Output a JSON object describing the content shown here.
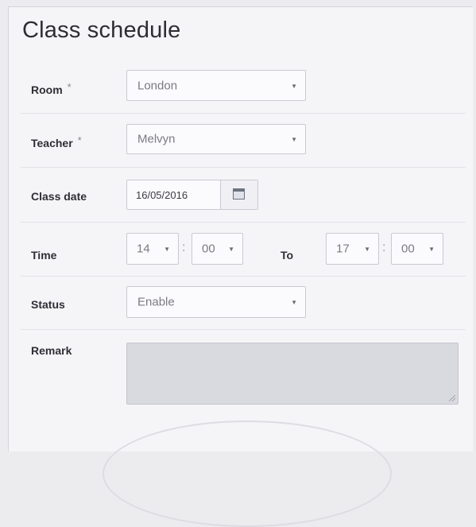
{
  "form": {
    "title": "Class schedule",
    "room": {
      "label": "Room",
      "required_mark": "*",
      "value": "London"
    },
    "teacher": {
      "label": "Teacher",
      "required_mark": "*",
      "value": "Melvyn"
    },
    "class_date": {
      "label": "Class date",
      "value": "16/05/2016",
      "icon": "calendar-icon"
    },
    "time": {
      "label": "Time",
      "from_hour": "14",
      "from_minute": "00",
      "separator": ":",
      "to_label": "To",
      "to_hour": "17",
      "to_minute": "00"
    },
    "status": {
      "label": "Status",
      "value": "Enable"
    },
    "remark": {
      "label": "Remark",
      "value": ""
    },
    "dropdown_arrow": "▼"
  },
  "colors": {
    "background": "#ececef",
    "panel": "#f5f5f8",
    "text": "#2e2e34",
    "field_text": "#7a7a82",
    "textarea_fill": "#d9d9e0"
  }
}
